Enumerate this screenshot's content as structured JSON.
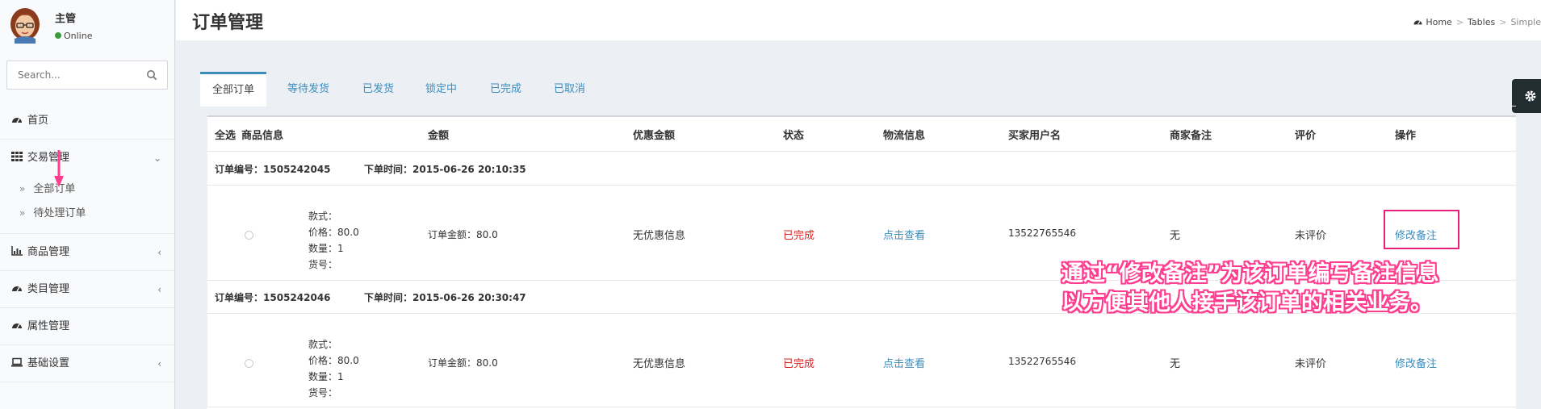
{
  "user": {
    "name": "主管",
    "status": "Online"
  },
  "search": {
    "placeholder": "Search..."
  },
  "sidebar": {
    "items": [
      {
        "label": "首页",
        "icon": "dashboard-icon"
      },
      {
        "label": "交易管理",
        "icon": "grid-icon",
        "expanded": true,
        "children": [
          {
            "label": "全部订单"
          },
          {
            "label": "待处理订单"
          }
        ]
      },
      {
        "label": "商品管理",
        "icon": "bar-chart-icon"
      },
      {
        "label": "类目管理",
        "icon": "dashboard-icon"
      },
      {
        "label": "属性管理",
        "icon": "dashboard-icon"
      },
      {
        "label": "基础设置",
        "icon": "laptop-icon"
      }
    ]
  },
  "header": {
    "title": "订单管理",
    "breadcrumb": [
      "Home",
      "Tables",
      "Simple"
    ]
  },
  "tabs": [
    "全部订单",
    "等待发货",
    "已发货",
    "锁定中",
    "已完成",
    "已取消"
  ],
  "table": {
    "columns": [
      "全选",
      "商品信息",
      "金额",
      "优惠金额",
      "状态",
      "物流信息",
      "买家用户名",
      "商家备注",
      "评价",
      "操作"
    ],
    "order_no_label": "订单编号：",
    "order_time_label": "下单时间：",
    "product_labels": {
      "style": "款式：",
      "price": "价格：",
      "qty": "数量：",
      "sku": "货号："
    },
    "amount_label": "订单金额：",
    "orders": [
      {
        "order_no": "1505242045",
        "time": "2015-06-26 20:10:35",
        "price": "80.0",
        "qty": "1",
        "amount": "80.0",
        "discount": "无优惠信息",
        "status": "已完成",
        "logistics": "点击查看",
        "buyer": "13522765546",
        "note": "无",
        "review": "未评价",
        "action": "修改备注"
      },
      {
        "order_no": "1505242046",
        "time": "2015-06-26 20:30:47",
        "price": "80.0",
        "qty": "1",
        "amount": "80.0",
        "discount": "无优惠信息",
        "status": "已完成",
        "logistics": "点击查看",
        "buyer": "13522765546",
        "note": "无",
        "review": "未评价",
        "action": "修改备注"
      }
    ]
  },
  "annotation": {
    "line1": "通过“修改备注”为该订单编写备注信息",
    "line2": "以方便其他人接手该订单的相关业务。",
    "color": "#ff3d8f"
  },
  "colors": {
    "accent": "#3c8dbc",
    "status_done": "#dd1f1f",
    "online": "#3c9a3c",
    "highlight": "#e8207a"
  }
}
